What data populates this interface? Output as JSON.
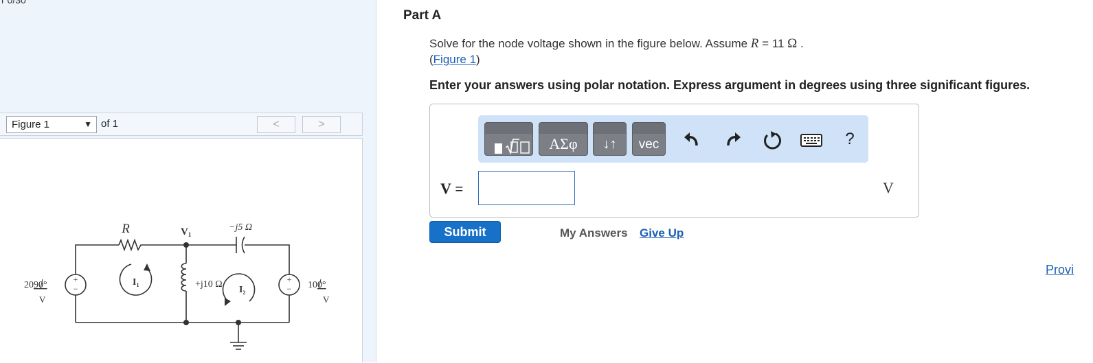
{
  "top_fragment": "r  0/30",
  "figure_panel": {
    "selector_value": "Figure 1",
    "of_text": "of 1",
    "prev_symbol": "<",
    "next_symbol": ">"
  },
  "circuit": {
    "r_label": "R",
    "v1_label": "V",
    "v1_sub": "1",
    "cap_label": "−j5 Ω",
    "ind_label": "+j10 Ω",
    "i1_label": "I",
    "i1_sub": "1",
    "i2_label": "I",
    "i2_sub": "2",
    "src_left_value": "20",
    "src_left_angle": "90°",
    "src_left_unit": "V",
    "src_right_value": "10",
    "src_right_angle": "0°",
    "src_right_unit": "V"
  },
  "part": {
    "title": "Part A",
    "problem_text": "Solve for the node voltage shown in the figure below. Assume ",
    "r_symbol": "R",
    "r_value": " = 11 ",
    "ohm": "Ω",
    "period": " .",
    "paren_open": "(",
    "figure_link": "Figure 1",
    "paren_close": ")",
    "instruction": "Enter your answers using polar notation. Express argument in degrees using three significant figures."
  },
  "toolbar": {
    "greek_label": "ΑΣφ",
    "arrows_label": "↓↑",
    "vec_label": "vec",
    "help_label": "?"
  },
  "answer": {
    "variable": "V",
    "equals": " =",
    "value": "",
    "unit": "V"
  },
  "actions": {
    "submit": "Submit",
    "my_answers": "My Answers",
    "give_up": "Give Up",
    "provide": "Provi"
  }
}
